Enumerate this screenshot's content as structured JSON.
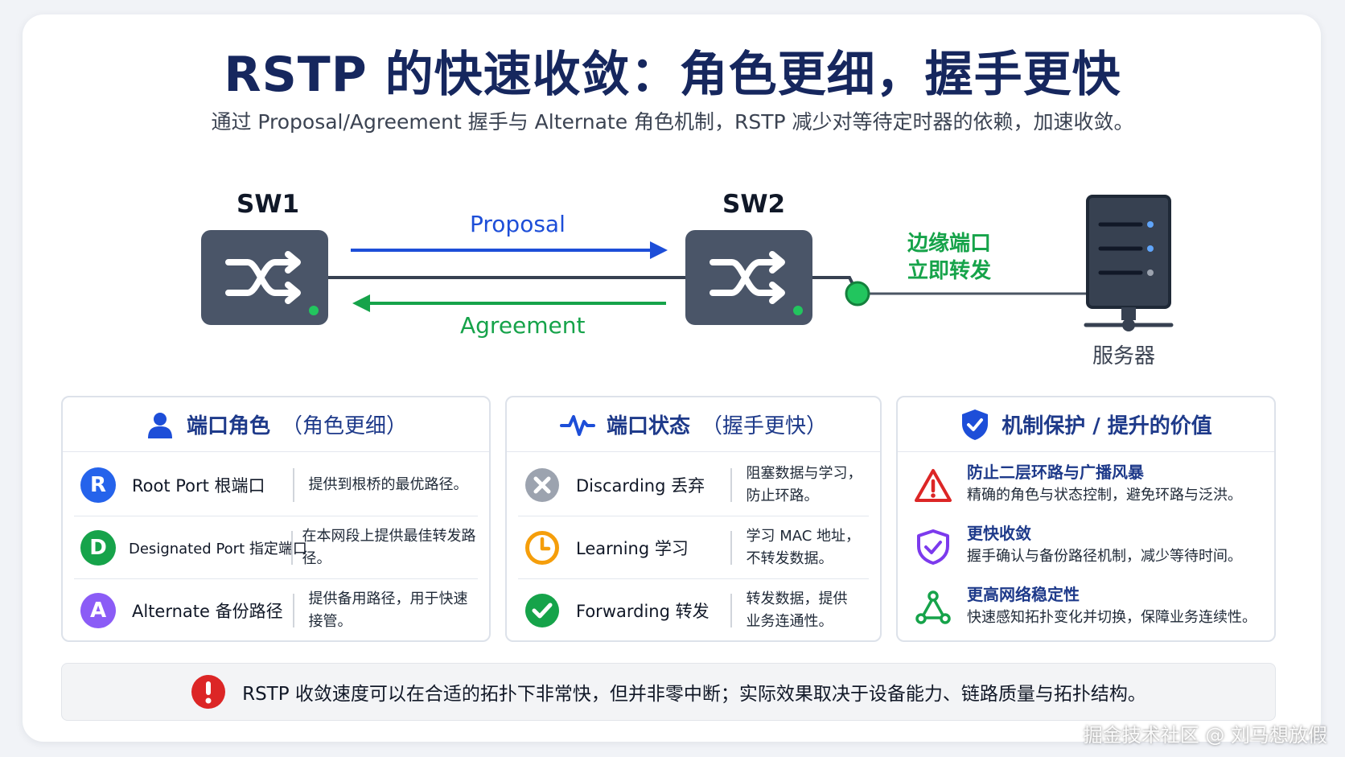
{
  "title": "RSTP 的快速收敛：角色更细，握手更快",
  "subtitle": "通过 Proposal/Agreement 握手与 Alternate 角色机制，RSTP 减少对等待定时器的依赖，加速收敛。",
  "diagram": {
    "sw1": "SW1",
    "sw2": "SW2",
    "proposal": "Proposal",
    "agreement": "Agreement",
    "edge_line1": "边缘端口",
    "edge_line2": "立即转发",
    "server": "服务器"
  },
  "panels": {
    "roles": {
      "title": "端口角色",
      "subtitle": "（角色更细）",
      "icon": "user-icon",
      "rows": [
        {
          "badge": "R",
          "color": "#2563eb",
          "name": "Root Port 根端口",
          "desc": "提供到根桥的最优路径。"
        },
        {
          "badge": "D",
          "color": "#16a34a",
          "name": "Designated Port 指定端口",
          "desc": "在本网段上提供最佳转发路径。"
        },
        {
          "badge": "A",
          "color": "#8b5cf6",
          "name": "Alternate 备份路径",
          "desc": "提供备用路径，用于快速接管。"
        }
      ]
    },
    "states": {
      "title": "端口状态",
      "subtitle": "（握手更快）",
      "icon": "pulse-icon",
      "rows": [
        {
          "icon": "x-circle-icon",
          "name": "Discarding 丢弃",
          "desc1": "阻塞数据与学习，",
          "desc2": "防止环路。"
        },
        {
          "icon": "clock-icon",
          "name": "Learning 学习",
          "desc1": "学习 MAC 地址，",
          "desc2": "不转发数据。"
        },
        {
          "icon": "check-circle-icon",
          "name": "Forwarding 转发",
          "desc1": "转发数据，提供",
          "desc2": "业务连通性。"
        }
      ]
    },
    "value": {
      "title": "机制保护 / 提升的价值",
      "icon": "shield-check-icon",
      "items": [
        {
          "icon": "warning-icon",
          "title": "防止二层环路与广播风暴",
          "desc": "精确的角色与状态控制，避免环路与泛洪。"
        },
        {
          "icon": "shield-icon",
          "title": "更快收敛",
          "desc": "握手确认与备份路径机制，减少等待时间。"
        },
        {
          "icon": "network-icon",
          "title": "更高网络稳定性",
          "desc": "快速感知拓扑变化并切换，保障业务连续性。"
        }
      ]
    }
  },
  "note": "RSTP 收敛速度可以在合适的拓扑下非常快，但并非零中断；实际效果取决于设备能力、链路质量与拓扑结构。",
  "watermark": "掘金技术社区 @ 刘马想放假",
  "colors": {
    "title": "#16275e",
    "blue": "#1d4ed8",
    "green": "#16a34a",
    "switch": "#4a5568"
  }
}
